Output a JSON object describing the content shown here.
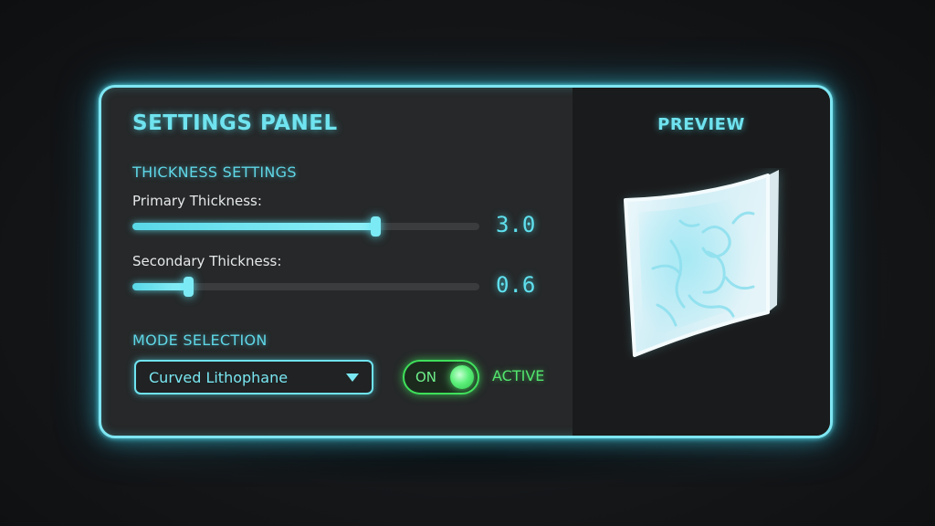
{
  "panel": {
    "title": "SETTINGS PANEL"
  },
  "thickness": {
    "section_label": "THICKNESS SETTINGS",
    "primary": {
      "label": "Primary Thickness:",
      "value": "3.0",
      "fill_fraction": 0.7
    },
    "secondary": {
      "label": "Secondary Thickness:",
      "value": "0.6",
      "fill_fraction": 0.16
    }
  },
  "mode": {
    "section_label": "MODE SELECTION",
    "dropdown_value": "Curved Lithophane",
    "toggle_label": "ON",
    "toggle_on": true,
    "status": "ACTIVE"
  },
  "preview": {
    "title": "PREVIEW",
    "image_icon": "curved-lithophane-preview"
  },
  "colors": {
    "accent": "#6fe3ef",
    "active_green": "#3fdf5a",
    "panel_background": "#262829",
    "preview_background": "#1a1b1c"
  }
}
